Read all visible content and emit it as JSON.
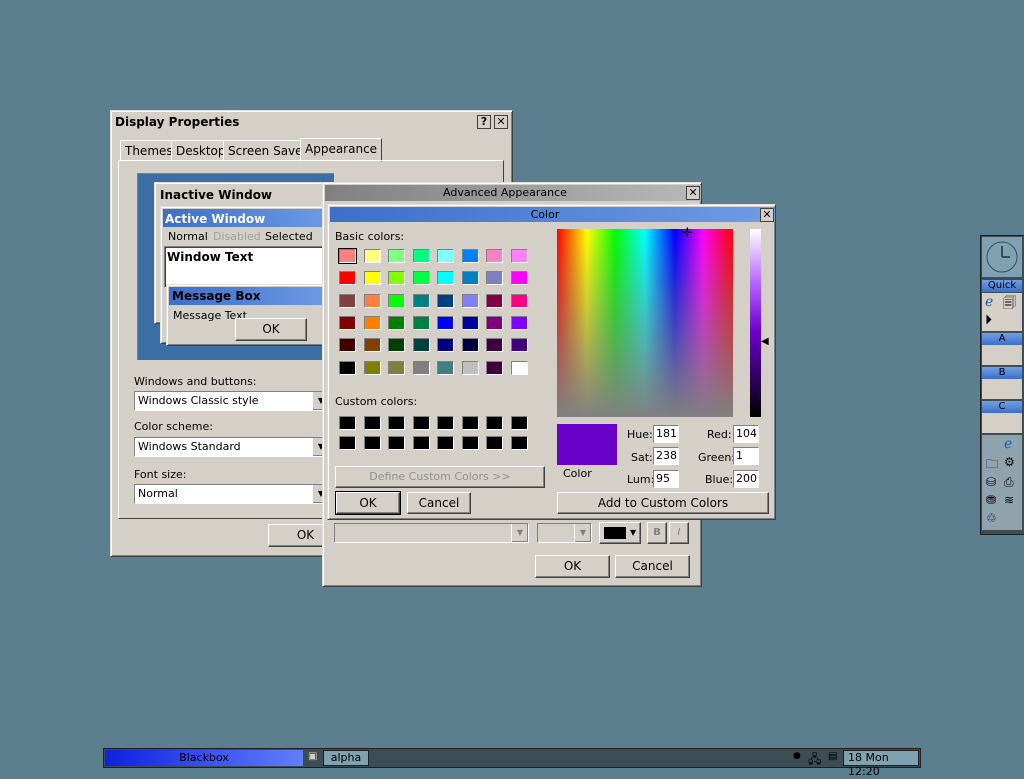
{
  "display_properties": {
    "title": "Display Properties",
    "help_btn": "?",
    "close_btn": "✕",
    "tabs": [
      "Themes",
      "Desktop",
      "Screen Saver",
      "Appearance"
    ],
    "preview": {
      "inactive_window": "Inactive Window",
      "active_window": "Active Window",
      "menu_normal": "Normal",
      "menu_disabled": "Disabled",
      "menu_selected": "Selected",
      "window_text": "Window Text",
      "message_box": "Message Box",
      "message_text": "Message Text",
      "ok": "OK"
    },
    "windows_buttons_label": "Windows and buttons:",
    "windows_buttons_value": "Windows Classic style",
    "color_scheme_label": "Color scheme:",
    "color_scheme_value": "Windows Standard",
    "font_size_label": "Font size:",
    "font_size_value": "Normal",
    "ok": "OK"
  },
  "advanced_appearance": {
    "title": "Advanced Appearance",
    "close_btn": "✕",
    "bold_btn": "B",
    "italic_btn": "I",
    "ok": "OK",
    "cancel": "Cancel"
  },
  "color_dialog": {
    "title": "Color",
    "close_btn": "✕",
    "basic_colors_label": "Basic colors:",
    "custom_colors_label": "Custom colors:",
    "define_custom": "Define Custom Colors >>",
    "ok": "OK",
    "cancel": "Cancel",
    "color_label": "Color",
    "hue_label": "Hue:",
    "hue": "181",
    "sat_label": "Sat:",
    "sat": "238",
    "lum_label": "Lum:",
    "lum": "95",
    "red_label": "Red:",
    "red": "104",
    "green_label": "Green:",
    "green": "1",
    "blue_label": "Blue:",
    "blue": "200",
    "add_custom": "Add to Custom Colors",
    "current_color": "#6800c8",
    "basic_colors": [
      "#ff8080",
      "#ffff80",
      "#80ff80",
      "#00ff80",
      "#80ffff",
      "#0080ff",
      "#ff80c0",
      "#ff80ff",
      "#ff0000",
      "#ffff00",
      "#80ff00",
      "#00ff40",
      "#00ffff",
      "#0080c0",
      "#8080c0",
      "#ff00ff",
      "#804040",
      "#ff8040",
      "#00ff00",
      "#008080",
      "#004080",
      "#8080ff",
      "#800040",
      "#ff0080",
      "#800000",
      "#ff8000",
      "#008000",
      "#008040",
      "#0000ff",
      "#0000a0",
      "#800080",
      "#8000ff",
      "#400000",
      "#804000",
      "#004000",
      "#004040",
      "#000080",
      "#000040",
      "#400040",
      "#400080",
      "#000000",
      "#808000",
      "#808040",
      "#808080",
      "#408080",
      "#c0c0c0",
      "#400040",
      "#ffffff"
    ]
  },
  "slit": {
    "quick_label": "Quick",
    "a_label": "A",
    "b_label": "B",
    "c_label": "C"
  },
  "taskbar": {
    "workspace": "Blackbox",
    "task": "alpha",
    "clock": "18 Mon 12:20"
  }
}
